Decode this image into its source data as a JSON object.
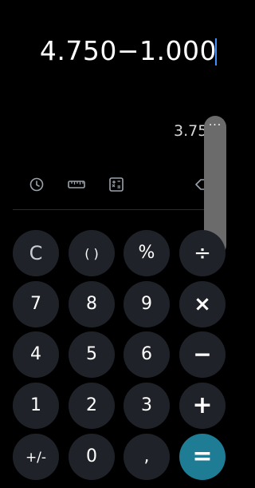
{
  "display": {
    "expression": "4.750−1.000",
    "result_preview": "3.75"
  },
  "toolbar": {
    "history_icon": "clock-icon",
    "unit_converter_icon": "ruler-icon",
    "scientific_icon": "scientific-mode-icon",
    "backspace_icon": "backspace-icon"
  },
  "side_panel": {
    "more_label": "···",
    "note_icon": "music-note-icon"
  },
  "keys": {
    "clear": "C",
    "parentheses": "( )",
    "percent": "%",
    "divide": "÷",
    "seven": "7",
    "eight": "8",
    "nine": "9",
    "multiply": "×",
    "four": "4",
    "five": "5",
    "six": "6",
    "minus": "−",
    "one": "1",
    "two": "2",
    "three": "3",
    "plus": "+",
    "negate": "+/-",
    "zero": "0",
    "decimal": ",",
    "equals": "="
  },
  "colors": {
    "background": "#000000",
    "key": "#1f2329",
    "equals_key": "#1e7d94",
    "cursor": "#3d8fff"
  }
}
